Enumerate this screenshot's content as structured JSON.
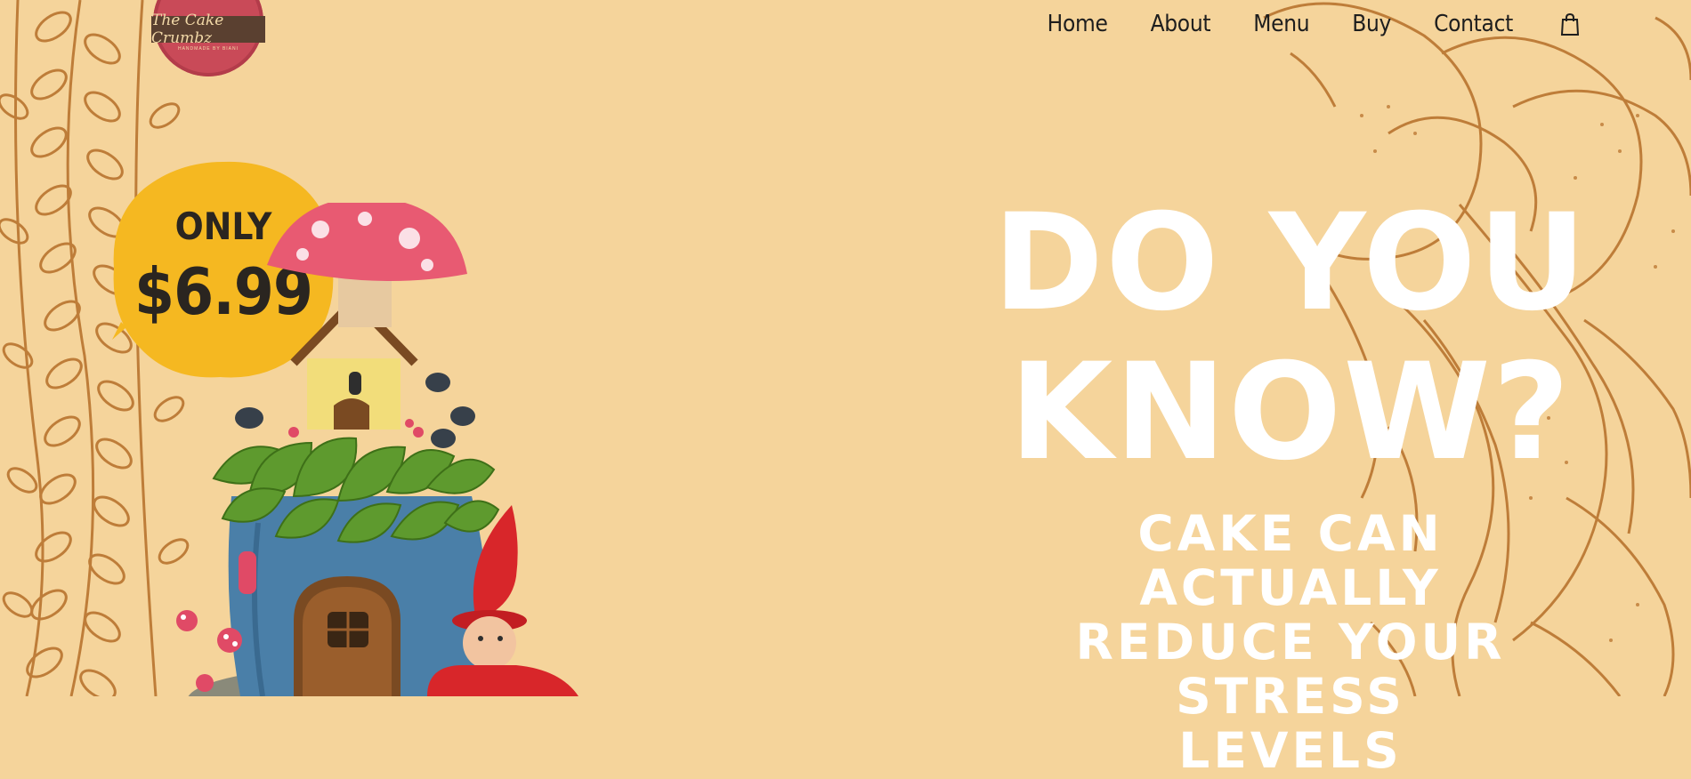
{
  "logo": {
    "name": "The Cake Crumbz",
    "tagline": "HANDMADE BY BIANI"
  },
  "nav": {
    "items": [
      "Home",
      "About",
      "Menu",
      "Buy",
      "Contact"
    ]
  },
  "badge": {
    "line1": "ONLY",
    "line2": "$6.99"
  },
  "hero": {
    "title_line1": "DO YOU",
    "title_line2": "KNOW?",
    "sub_line1": "CAKE CAN ACTUALLY",
    "sub_line2": "REDUCE YOUR STRESS",
    "sub_line3": "LEVELS"
  },
  "colors": {
    "background": "#f5d49b",
    "line_art": "#b8732e",
    "badge": "#f5b821",
    "logo": "#c94a58"
  },
  "icons": [
    "shopping-bag-icon"
  ]
}
